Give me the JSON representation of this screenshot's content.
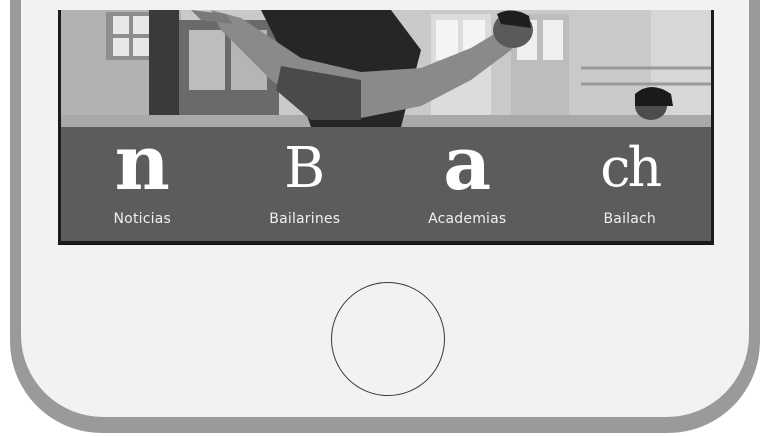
{
  "nav": {
    "items": [
      {
        "glyph": "n",
        "label": "Noticias"
      },
      {
        "glyph": "B",
        "label": "Bailarines"
      },
      {
        "glyph": "a",
        "label": "Academias"
      },
      {
        "glyph": "ch",
        "label": "Bailach"
      }
    ]
  },
  "colors": {
    "nav_background": "#5c5c5c",
    "nav_text": "#ffffff",
    "phone_frame": "#9a9a9a",
    "phone_face": "#f2f2f2"
  },
  "icons": {
    "home": "home-button-circle"
  }
}
